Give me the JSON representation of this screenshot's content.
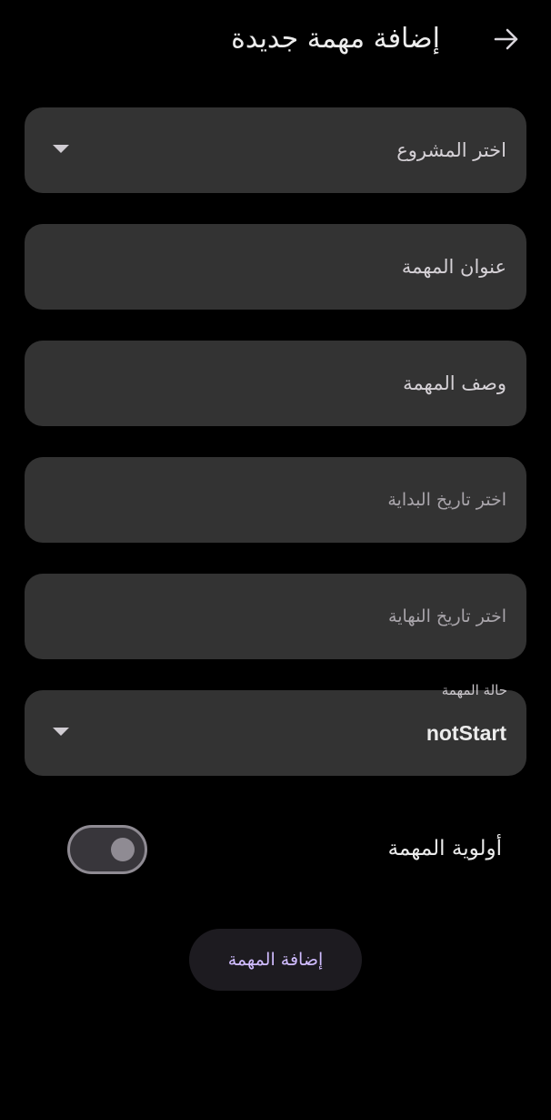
{
  "appbar": {
    "title": "إضافة مهمة جديدة",
    "back_icon": "arrow-forward-icon"
  },
  "form": {
    "project_select": {
      "label": "اختر المشروع",
      "icon": "dropdown-arrow-icon"
    },
    "task_title": {
      "placeholder": "عنوان المهمة"
    },
    "task_description": {
      "placeholder": "وصف المهمة"
    },
    "start_date": {
      "hint": "اختر تاريخ البداية"
    },
    "end_date": {
      "hint": "اختر تاريخ النهاية"
    },
    "status_select": {
      "label": "حالة المهمة",
      "value": "notStart",
      "icon": "dropdown-arrow-icon"
    },
    "priority": {
      "label": "أولوية المهمة",
      "enabled": false
    },
    "submit_label": "إضافة المهمة"
  },
  "colors": {
    "background": "#000000",
    "field_background": "#333333",
    "button_background": "#1d1b20",
    "button_text": "#d0bcff",
    "switch_outline": "#8f8b93"
  }
}
